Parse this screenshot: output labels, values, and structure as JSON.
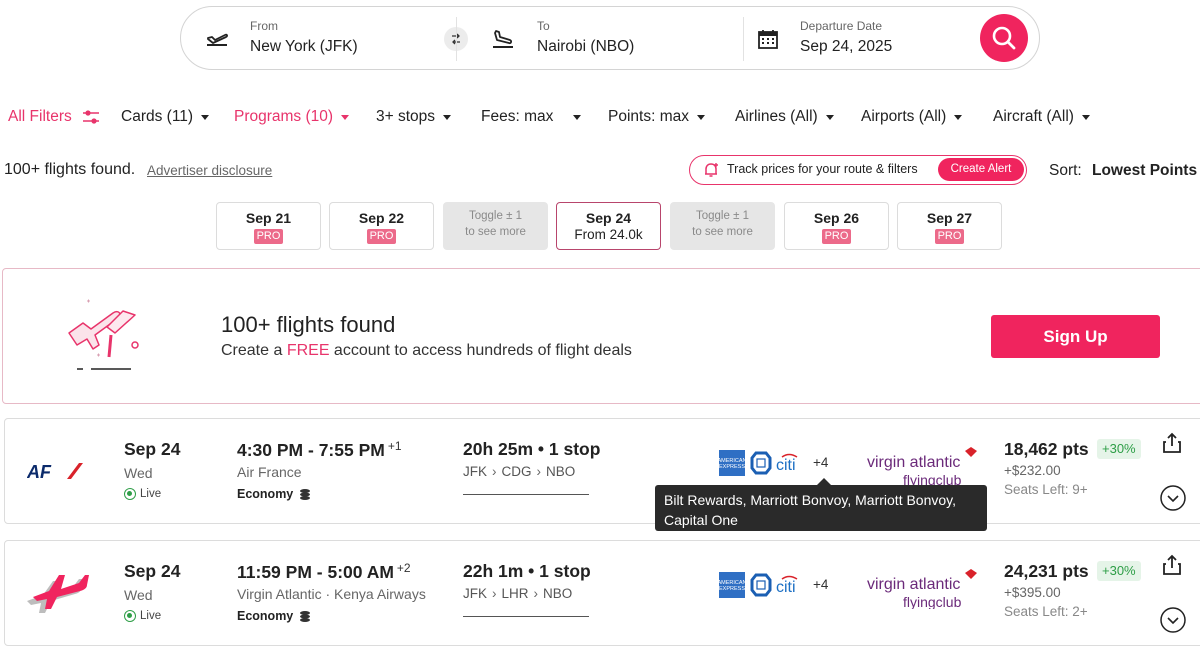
{
  "search": {
    "from_label": "From",
    "from_value": "New York (JFK)",
    "to_label": "To",
    "to_value": "Nairobi (NBO)",
    "date_label": "Departure Date",
    "date_value": "Sep 24, 2025"
  },
  "filters": {
    "all": "All Filters",
    "cards": "Cards (11)",
    "programs": "Programs (10)",
    "stops": "3+ stops",
    "fees": "Fees: max",
    "points": "Points: max",
    "airlines": "Airlines (All)",
    "airports": "Airports (All)",
    "aircraft": "Aircraft (All)"
  },
  "results": {
    "found": "100+ flights found.",
    "disclosure": "Advertiser disclosure",
    "track_text": "Track prices for your route & filters",
    "create_alert": "Create Alert",
    "sort_label": "Sort:",
    "sort_value": "Lowest Points"
  },
  "date_tabs": [
    {
      "date": "Sep 21",
      "badge": "PRO"
    },
    {
      "date": "Sep 22",
      "badge": "PRO"
    },
    {
      "line1": "Toggle ± 1",
      "line2": "to see more"
    },
    {
      "date": "Sep 24",
      "sub": "From 24.0k"
    },
    {
      "line1": "Toggle ± 1",
      "line2": "to see more"
    },
    {
      "date": "Sep 26",
      "badge": "PRO"
    },
    {
      "date": "Sep 27",
      "badge": "PRO"
    }
  ],
  "banner": {
    "title": "100+ flights found",
    "sub_prefix": "Create a ",
    "sub_free": "FREE",
    "sub_suffix": " account to access hundreds of flight deals",
    "signup": "Sign Up"
  },
  "flights": [
    {
      "airline_logo": "AF",
      "date": "Sep 24",
      "dow": "Wed",
      "live": "Live",
      "time": "4:30 PM - 7:55 PM",
      "day_offset": "+1",
      "airline": "Air France",
      "cabin": "Economy",
      "duration": "20h 25m • 1 stop",
      "route": [
        "JFK",
        "CDG",
        "NBO"
      ],
      "cards_more": "+4",
      "program_line1": "virgin atlantic",
      "program_line2": "flyingclub",
      "points": "18,462 pts",
      "bonus": "+30%",
      "fee": "+$232.00",
      "seats": "Seats Left: 9+"
    },
    {
      "airline_logo": "plane",
      "date": "Sep 24",
      "dow": "Wed",
      "live": "Live",
      "time": "11:59 PM - 5:00 AM",
      "day_offset": "+2",
      "airline": "Virgin Atlantic · Kenya Airways",
      "cabin": "Economy",
      "duration": "22h 1m • 1 stop",
      "route": [
        "JFK",
        "LHR",
        "NBO"
      ],
      "cards_more": "+4",
      "program_line1": "virgin atlantic",
      "program_line2": "flyingclub",
      "points": "24,231 pts",
      "bonus": "+30%",
      "fee": "+$395.00",
      "seats": "Seats Left: 2+"
    }
  ],
  "tooltip": {
    "line1": "Bilt Rewards, Marriott Bonvoy, Marriott Bonvoy,",
    "line2": "Capital One"
  },
  "colors": {
    "brand_pink": "#f0245e",
    "accent_pink_text": "#e8346b",
    "pro_badge": "#ec6a8a",
    "live_green": "#2e9e47",
    "amex_blue": "#2f6fc4",
    "virgin_purple": "#6b2a7a"
  }
}
